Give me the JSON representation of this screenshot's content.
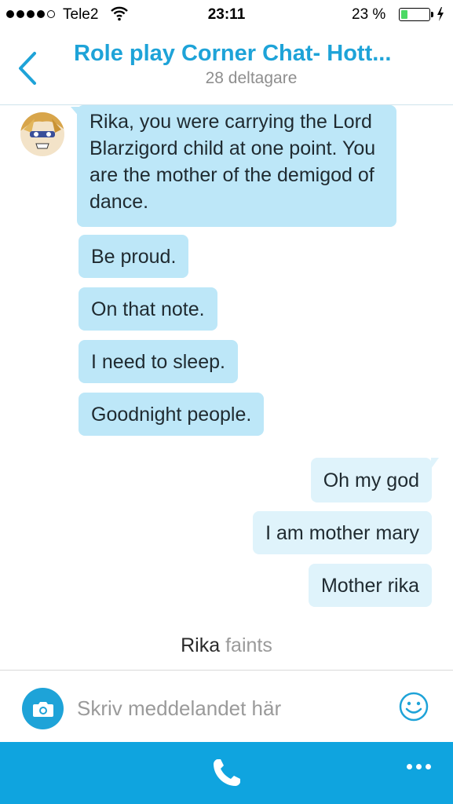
{
  "status_bar": {
    "carrier": "Tele2",
    "time": "23:11",
    "battery_percent": "23 %",
    "signal_bars": 4,
    "battery_level": 0.23
  },
  "header": {
    "title": "Role play Corner Chat- Hott...",
    "subtitle": "28 deltagare"
  },
  "messages_in": [
    "Rika, you were carrying the Lord Blarzigord child at one point. You are the mother of the demigod of dance.",
    "Be proud.",
    "On that note.",
    "I need to sleep.",
    "Goodnight people."
  ],
  "messages_out": [
    "Oh my god",
    "I am mother mary",
    "Mother rika"
  ],
  "system_message": {
    "name": "Rika",
    "action": "faints"
  },
  "composer": {
    "placeholder": "Skriv meddelandet här"
  },
  "colors": {
    "accent": "#1ea3d8",
    "incoming_bubble": "#bde7f8",
    "outgoing_bubble": "#dff3fb",
    "bottom_bar": "#0fa4df"
  },
  "icons": [
    "back-chevron-icon",
    "camera-icon",
    "smiley-icon",
    "phone-icon",
    "more-dots-icon",
    "wifi-icon",
    "battery-icon",
    "charging-bolt-icon"
  ]
}
